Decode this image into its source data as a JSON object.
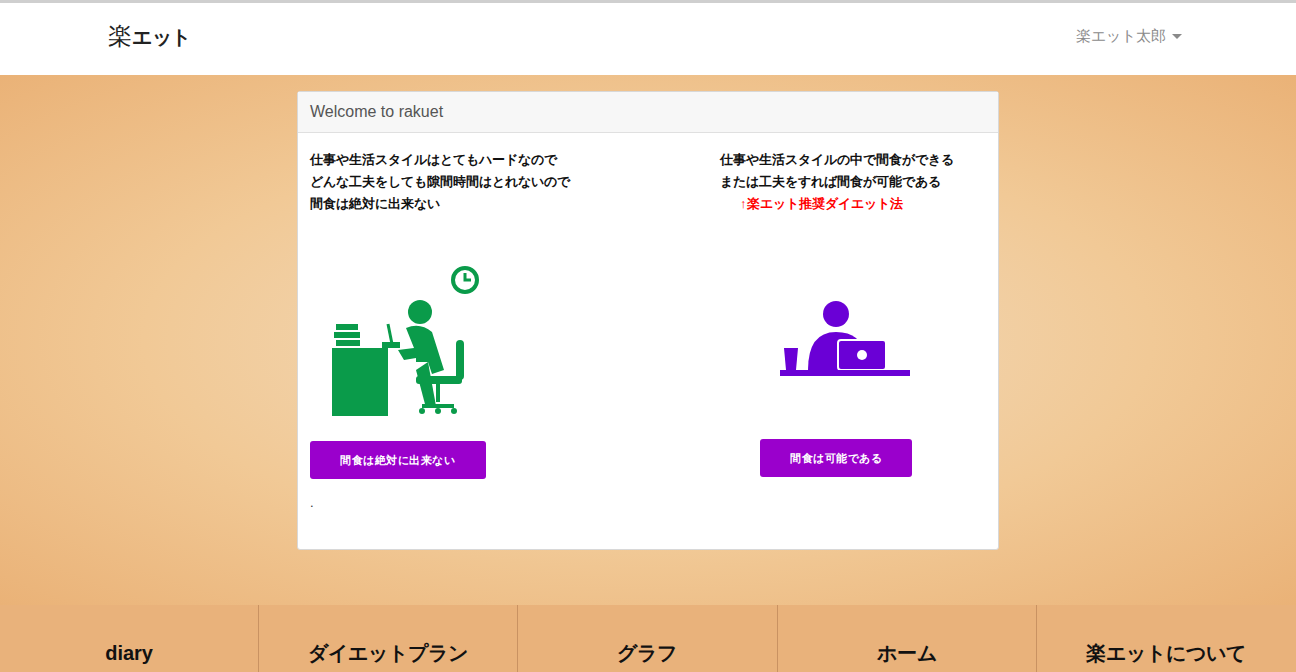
{
  "navbar": {
    "logo": {
      "kanji": "楽",
      "kana": "エット"
    },
    "user_menu": {
      "label": "楽エット太郎"
    }
  },
  "card": {
    "header": "Welcome to rakuet",
    "options": [
      {
        "kind": "desk",
        "color": "#0a9b4a",
        "lines": [
          "仕事や生活スタイルはとてもハードなので",
          "どんな工夫をしても隙間時間はとれないので",
          "間食は絶対に出来ない"
        ],
        "note": "",
        "button": "間食は絶対に出来ない"
      },
      {
        "kind": "laptop",
        "color": "#6a00d6",
        "lines": [
          "仕事や生活スタイルの中で間食ができる",
          "または工夫をすれば間食が可能である"
        ],
        "note": "↑楽エット推奨ダイエット法",
        "button": "間食は可能である"
      }
    ],
    "footnote": "."
  },
  "bottom_nav": [
    {
      "label": "diary"
    },
    {
      "label": "ダイエットプラン"
    },
    {
      "label": "グラフ"
    },
    {
      "label": "ホーム"
    },
    {
      "label": "楽エットについて"
    }
  ]
}
